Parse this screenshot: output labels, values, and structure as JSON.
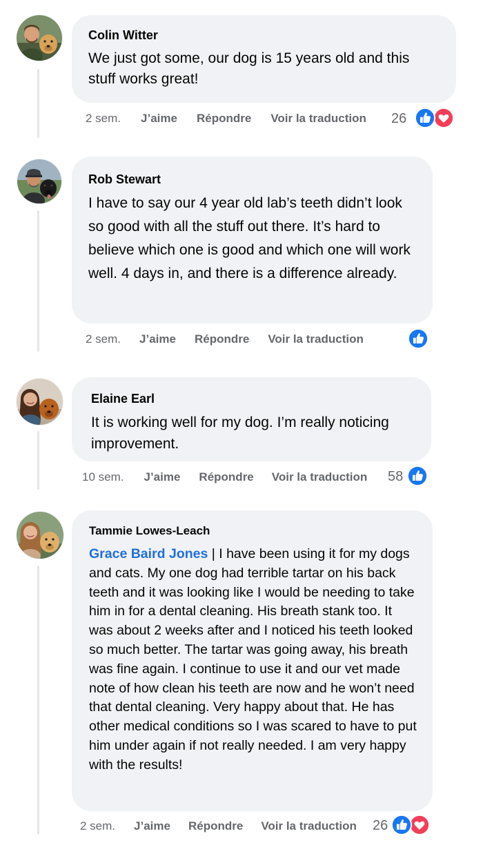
{
  "colors": {
    "bubble": "#f0f2f5",
    "meta_text": "#65676b",
    "mention": "#216fdb",
    "like_blue": "#1877f2",
    "love_red": "#f33e58"
  },
  "comments": [
    {
      "author": "Colin Witter",
      "text": "We just got some, our dog is 15 years old and this stuff works great!",
      "time": "2 sem.",
      "like": "J’aime",
      "reply": "Répondre",
      "translate": "Voir la traduction",
      "reaction_count": "26",
      "reactions": [
        "like-icon",
        "love-icon"
      ]
    },
    {
      "author": "Rob Stewart",
      "text": "I have to say our 4 year old lab’s teeth didn’t look so good with all the stuff out there. It’s hard to believe which one is good and which one will work well. 4 days in, and there is a difference already.",
      "time": "2 sem.",
      "like": "J’aime",
      "reply": "Répondre",
      "translate": "Voir la traduction",
      "reaction_count": "",
      "reactions": [
        "like-icon"
      ]
    },
    {
      "author": "Elaine Earl",
      "text": "It is working well for my dog. I’m really noticing improvement.",
      "time": "10 sem.",
      "like": "J’aime",
      "reply": "Répondre",
      "translate": "Voir la traduction",
      "reaction_count": "58",
      "reactions": [
        "like-icon"
      ]
    },
    {
      "author": "Tammie Lowes-Leach",
      "mention": "Grace Baird Jones",
      "text": " | I have been using it for my dogs and cats. My one dog had terrible tartar on his back teeth and it was looking like I would be needing to take him in for a dental cleaning. His breath stank too. It was about 2 weeks after and I noticed his teeth looked so much better. The tartar was going away, his breath was fine again. I continue to use it and our vet made note of how clean his teeth are now and he won’t need that dental cleaning. Very happy about that. He has other medical conditions so I was scared to have to put him under again if not really needed. I am very happy with the results!",
      "time": "2 sem.",
      "like": "J’aime",
      "reply": "Répondre",
      "translate": "Voir la traduction",
      "reaction_count": "26",
      "reactions": [
        "like-icon",
        "love-icon"
      ]
    }
  ]
}
